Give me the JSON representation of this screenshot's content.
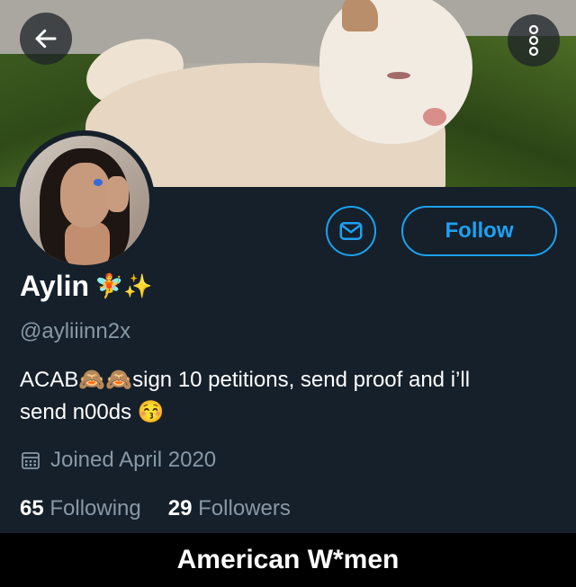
{
  "profile": {
    "name": "Aylin",
    "name_emojis": "🧚✨",
    "handle": "@ayliiinn2x",
    "bio_line1": "ACAB🙈🙈sign 10 petitions, send proof and i’ll",
    "bio_line2": "send n00ds 😚",
    "joined": "Joined April 2020"
  },
  "stats": {
    "following_count": "65",
    "following_label": "Following",
    "followers_count": "29",
    "followers_label": "Followers"
  },
  "actions": {
    "follow_label": "Follow"
  },
  "icons": {
    "back": "arrow-left-icon",
    "more": "more-vertical-icon",
    "message": "envelope-icon",
    "calendar": "calendar-icon"
  },
  "caption": "American W*men",
  "colors": {
    "background": "#15202b",
    "accent": "#1da1f2",
    "secondary_text": "#8899a6"
  }
}
